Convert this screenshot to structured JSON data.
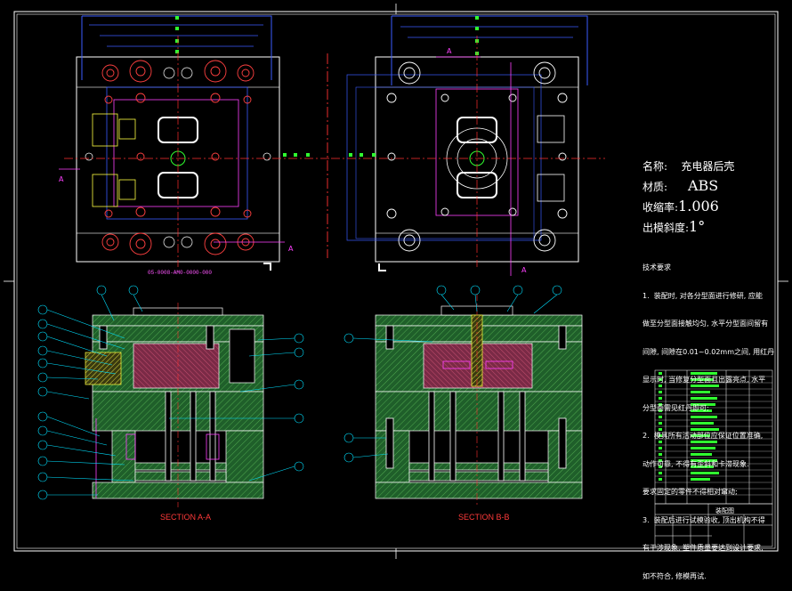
{
  "drawing": {
    "properties": {
      "name_label": "名称:",
      "name_value": "充电器后壳",
      "material_label": "材质:",
      "material_value": "ABS",
      "shrink_label": "收缩率:",
      "shrink_value": "1.006",
      "draft_label": "出模斜度:",
      "draft_value": "1°"
    },
    "tech_requirements": {
      "title": "技术要求",
      "lines": [
        "1.  装配时, 对各分型面进行修研, 应能",
        "做至分型面接触均匀, 水平分型面间留有",
        "间隙, 间隙在0.01~0.02mm之间, 用红丹",
        "显示时, 当修复分型面且出露亮点, 水平",
        "分型面需见红丹即可;",
        "2.  模具所有活动部位应保证位置准确,",
        "动作可靠, 不得有歪斜和卡滞现象.",
        "要求固定的零件不得相对窜动;",
        "3.  装配后进行试模验收, 顶出机构不得",
        "有干涉现象, 塑件质量要达到设计要求,",
        "如不符合, 修模再试."
      ]
    },
    "section_labels": {
      "a": "SECTION A-A",
      "b": "SECTION B-B"
    },
    "section_markers": [
      "A",
      "A",
      "A",
      "A"
    ],
    "part_number": "05-0008-AM0-0000-000",
    "title_block": {
      "caption": "装配图"
    },
    "colors": {
      "background": "#000000",
      "frame": "#ffffff",
      "plate_fill": "#1f5f2a",
      "cavity_fill": "#8a2f4a",
      "blue_line": "#3a5bff",
      "magenta_line": "#ff40ff",
      "red_line": "#ff3030",
      "cyan": "#00e0ff",
      "yellow": "#ffff40",
      "green_marker": "#30ff30"
    }
  }
}
